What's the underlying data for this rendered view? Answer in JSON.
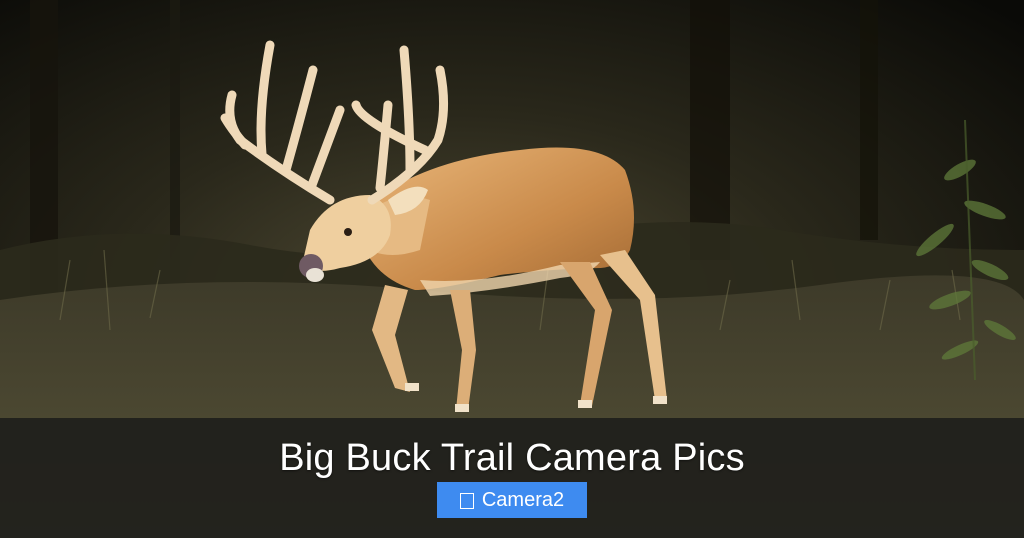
{
  "header": {
    "title": "Big Buck Trail Camera Pics"
  },
  "tag": {
    "label": "Camera2",
    "icon": "tag-icon",
    "color": "#3e8bf0"
  },
  "overlay": {
    "color": "#1c1c1a"
  }
}
